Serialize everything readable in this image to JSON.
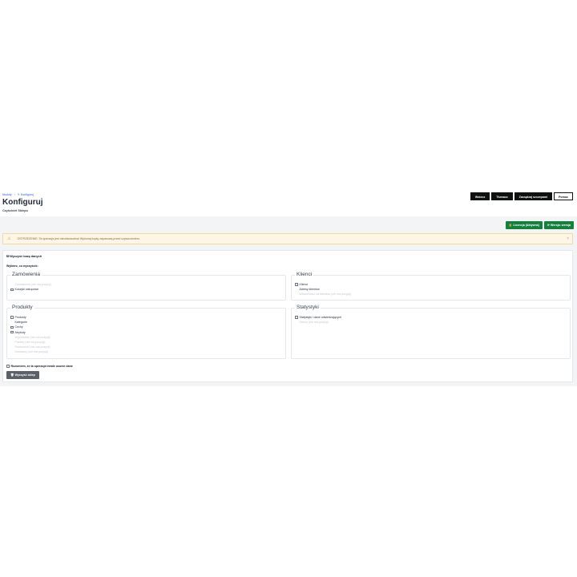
{
  "breadcrumb": {
    "root": "Moduły",
    "sep": "›",
    "current": "Konfiguruj",
    "current_icon": "edit-icon"
  },
  "header": {
    "title": "Konfiguruj",
    "subtitle": "Czyściciel Sklepu"
  },
  "toolbar": {
    "buttons": [
      "Wstecz",
      "Tłumacz",
      "Zarządzaj szczepami",
      "Pomoc"
    ]
  },
  "actions": {
    "license": "Licencja (Aktywna)",
    "license_icon": "lock-icon",
    "version": "Wersja: wersja",
    "version_icon": "refresh-icon"
  },
  "alert": {
    "text": "OSTRZEŻENIE: Ta operacja jest nieodwracalna! Wykonaj kopię zapasową przed czyszczeniem.",
    "icon": "warning-icon",
    "close": "×"
  },
  "panel": {
    "title": "Wyczyść bazę danych",
    "title_icon": "database-icon",
    "choose_label": "Wybierz, co wyczyścić:",
    "groups": {
      "orders": {
        "title": "Zamówienia",
        "items": [
          {
            "label": "Zamówienia (nie ma pozycji)",
            "disabled": true,
            "nobox": true
          },
          {
            "label": "Koszyki zakupowe",
            "disabled": false
          }
        ]
      },
      "customers": {
        "title": "Klienci",
        "items": [
          {
            "label": "Klienci",
            "disabled": false
          },
          {
            "label": "Adresy klientów",
            "disabled": false,
            "nobox": true
          },
          {
            "label": "Wiadomości od klientów (nie ma pozycji)",
            "disabled": true,
            "nobox": true
          }
        ]
      },
      "products": {
        "title": "Produkty",
        "items": [
          {
            "label": "Produkty",
            "disabled": false
          },
          {
            "label": "Kategorie",
            "disabled": false,
            "nobox": true
          },
          {
            "label": "Cechy",
            "disabled": false
          },
          {
            "label": "Atrybuty",
            "disabled": false
          },
          {
            "label": "Wyprzedaż (nie ma pozycji)",
            "disabled": true,
            "nobox": true
          },
          {
            "label": "Pakiety (nie ma pozycji)",
            "disabled": true,
            "nobox": true
          },
          {
            "label": "Producenci (nie ma pozycji)",
            "disabled": true,
            "nobox": true
          },
          {
            "label": "Dostawcy (nie ma pozycji)",
            "disabled": true,
            "nobox": true
          }
        ]
      },
      "stats": {
        "title": "Statystyki",
        "items": [
          {
            "label": "Statystyki i dane odwiedzających",
            "disabled": false
          },
          {
            "label": "Strony (nie ma pozycji)",
            "disabled": true,
            "nobox": true
          }
        ]
      }
    },
    "confirm_label": "Rozumiem, że ta operacja trwale usunie dane",
    "clean_button": "Wyczyść sklep",
    "clean_icon": "trash-icon"
  }
}
